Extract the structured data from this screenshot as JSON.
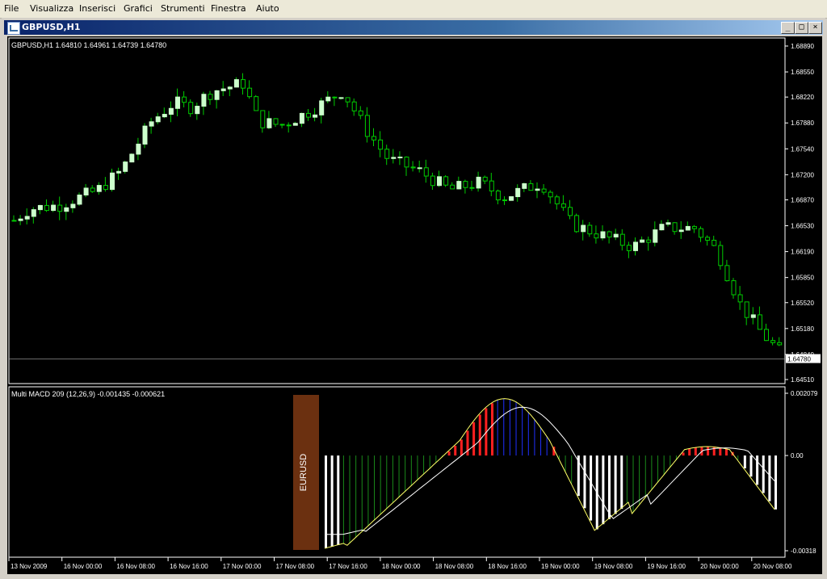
{
  "menu": [
    "File",
    "Visualizza",
    "Inserisci",
    "Grafici",
    "Strumenti",
    "Finestra",
    "Aiuto"
  ],
  "window": {
    "title": "GBPUSD,H1",
    "min_btn": "_",
    "max_btn": "□",
    "close_btn": "×"
  },
  "main": {
    "info": "GBPUSD,H1  1.64810 1.64961 1.64739 1.64780",
    "price_labels": [
      "1.68890",
      "1.68550",
      "1.68220",
      "1.67880",
      "1.67540",
      "1.67200",
      "1.66870",
      "1.66530",
      "1.66190",
      "1.65850",
      "1.65520",
      "1.65180",
      "1.64840",
      "1.64510"
    ],
    "current_price": "1.64780",
    "bull_color": "#ccffcc",
    "bear_color": "#000000",
    "wick_color": "#00cc00",
    "ohlc_seed": {
      "open": 1.669,
      "close": 1.6478,
      "bars": 236
    }
  },
  "sub": {
    "info": "Multi MACD 209 (12,26,9) -0.001435 -0.000621",
    "label": "EURUSD",
    "label_bg": "#6b3010",
    "levels": [
      "0.002079",
      "0.00",
      "-0.00318"
    ],
    "colors": {
      "up": "#ff2020",
      "mid": "#2030ff",
      "green": "#1a8a1a",
      "white": "#ffffff",
      "signal": "#ffff66",
      "macd": "#ffffff"
    }
  },
  "time_axis": [
    "13 Nov 2009",
    "16 Nov 00:00",
    "16 Nov 08:00",
    "16 Nov 16:00",
    "17 Nov 00:00",
    "17 Nov 08:00",
    "17 Nov 16:00",
    "18 Nov 00:00",
    "18 Nov 08:00",
    "18 Nov 16:00",
    "19 Nov 00:00",
    "19 Nov 08:00",
    "19 Nov 16:00",
    "20 Nov 00:00",
    "20 Nov 08:00"
  ]
}
